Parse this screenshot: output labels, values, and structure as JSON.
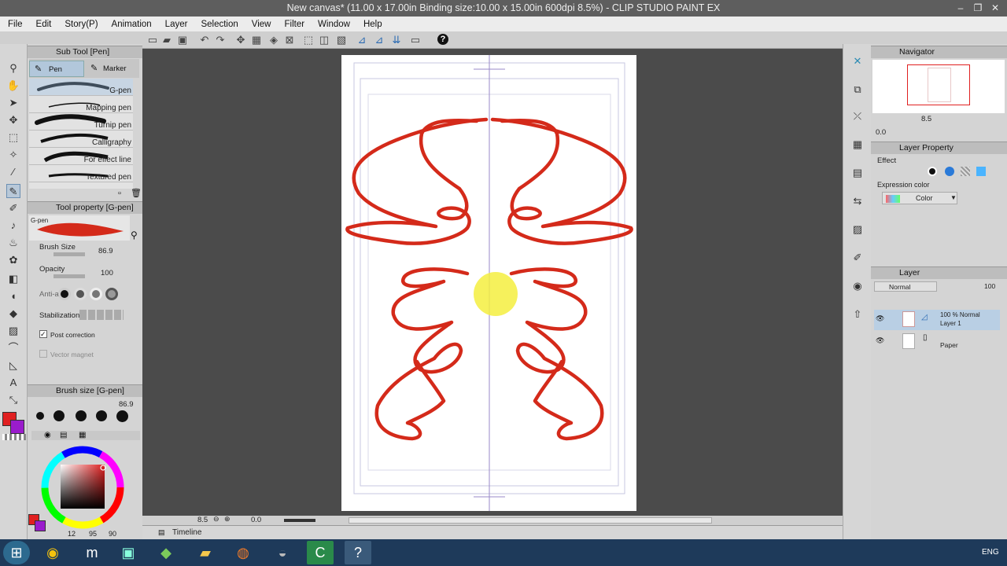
{
  "window": {
    "title": "New canvas* (11.00 x 17.00in Binding size:10.00 x 15.00in 600dpi 8.5%)  - CLIP STUDIO PAINT EX",
    "minimize": "–",
    "restore": "❐",
    "close": "✕"
  },
  "menu": [
    "File",
    "Edit",
    "Story(P)",
    "Animation",
    "Layer",
    "Selection",
    "View",
    "Filter",
    "Window",
    "Help"
  ],
  "cmdbar": {
    "help_glyph": "?"
  },
  "subtool": {
    "title": "Sub Tool [Pen]",
    "tabs": [
      "Pen",
      "Marker"
    ],
    "brushes": [
      "G-pen",
      "Mapping pen",
      "Turnip pen",
      "Calligraphy",
      "For effect line",
      "Textured pen"
    ]
  },
  "toolprop": {
    "title": "Tool property [G-pen]",
    "preview_label": "G-pen",
    "brush_size_label": "Brush Size",
    "brush_size": "86.9",
    "opacity_label": "Opacity",
    "opacity": "100",
    "antialias_label": "Anti-a",
    "stabilization_label": "Stabilization",
    "post_correction_label": "Post correction",
    "vector_magnet_label": "Vector magnet"
  },
  "brushsize": {
    "title": "Brush size [G-pen]",
    "value": "86.9"
  },
  "color": {
    "main": "#e02020",
    "sub": "#9a1ccc",
    "small_main": "#e02020",
    "small_sub": "#9a1ccc",
    "readout": [
      "12",
      "95",
      "90"
    ]
  },
  "canvas": {
    "zoom": "8.5",
    "rotation": "0.0",
    "stroke_color": "#d42a1a",
    "cursor_color": "#f4ee40"
  },
  "timeline": {
    "label": "Timeline"
  },
  "navigator": {
    "title": "Navigator",
    "zoom": "8.5",
    "rotation": "0.0"
  },
  "layerprop": {
    "title": "Layer Property",
    "effect_label": "Effect",
    "expression_label": "Expression color",
    "expression_value": "Color"
  },
  "layers": {
    "title": "Layer",
    "blend": "Normal",
    "opacity": "100",
    "items": [
      {
        "top": "100 %  Normal",
        "name": "Layer 1"
      },
      {
        "name": "Paper"
      }
    ]
  },
  "taskbar": {
    "lang": "ENG"
  }
}
